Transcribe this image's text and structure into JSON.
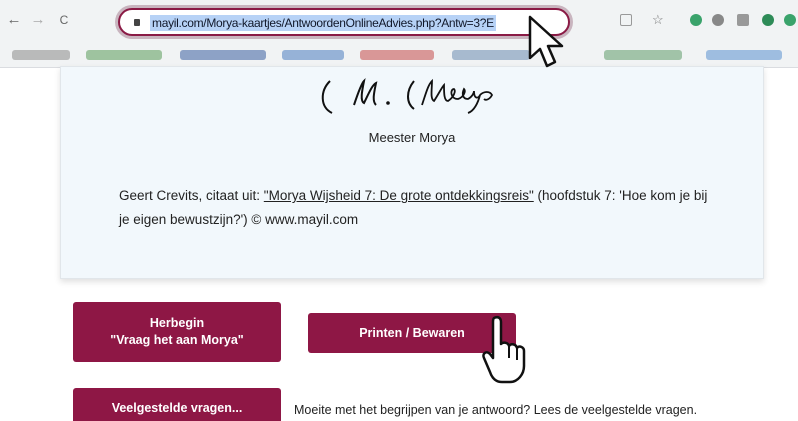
{
  "browser": {
    "url": "mayil.com/Morya-kaartjes/AntwoordenOnlineAdvies.php?Antw=3?E",
    "back_icon": "←",
    "forward_icon": "→",
    "reload_icon": "C"
  },
  "card": {
    "signer": "Meester Morya",
    "quote_prefix": "Geert Crevits, citaat uit: ",
    "quote_book": "\"Morya Wijsheid 7: De grote ontdekkingsreis\"",
    "quote_suffix": " (hoofdstuk 7: 'Hoe kom je bij je eigen bewustzijn?') © www.mayil.com"
  },
  "buttons": {
    "herbegin_line1": "Herbegin",
    "herbegin_line2": "\"Vraag het aan Morya\"",
    "print": "Printen / Bewaren",
    "faq": "Veelgestelde vragen..."
  },
  "faq_hint": "Moeite met het begrijpen van je antwoord? Lees de veelgestelde vragen.",
  "colors": {
    "accent": "#8e1745",
    "card_bg": "#f2f8fc",
    "url_highlight": "#b7d2f6"
  },
  "icons": [
    "back-arrow-icon",
    "forward-arrow-icon",
    "reload-icon",
    "lock-icon",
    "share-icon",
    "star-icon",
    "extension-icon",
    "pointer-cursor-icon",
    "hand-cursor-icon"
  ]
}
